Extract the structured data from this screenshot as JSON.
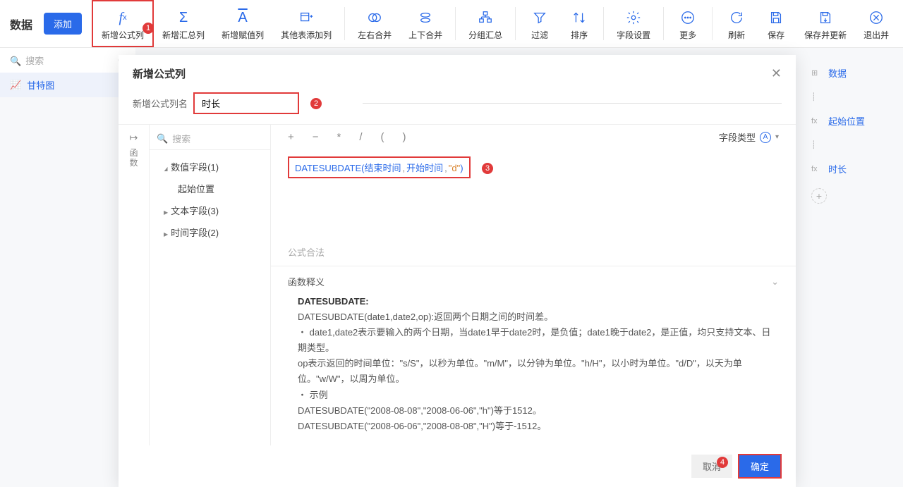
{
  "toolbar": {
    "title": "数据",
    "add": "添加",
    "items": [
      {
        "label": "新增公式列"
      },
      {
        "label": "新增汇总列"
      },
      {
        "label": "新增赋值列"
      },
      {
        "label": "其他表添加列"
      },
      {
        "label": "左右合并"
      },
      {
        "label": "上下合并"
      },
      {
        "label": "分组汇总"
      },
      {
        "label": "过滤"
      },
      {
        "label": "排序"
      },
      {
        "label": "字段设置"
      },
      {
        "label": "更多"
      },
      {
        "label": "刷新"
      },
      {
        "label": "保存"
      },
      {
        "label": "保存并更新"
      },
      {
        "label": "退出并"
      }
    ],
    "search_ph": "搜索",
    "gantt": "甘特图"
  },
  "right": {
    "data": "数据",
    "start": "起始位置",
    "dur": "时长"
  },
  "modal": {
    "title": "新增公式列",
    "name_label": "新增公式列名",
    "name_value": "时长",
    "ftype_label": "字段类型",
    "field_search_ph": "搜索",
    "tree": {
      "num": "数值字段(1)",
      "num_child": "起始位置",
      "text": "文本字段(3)",
      "time": "时间字段(2)"
    },
    "side_label": "函数",
    "formula": {
      "fn": "DATESUBDATE",
      "a1": "结束时间",
      "a2": "开始时间",
      "a3": "\"d\""
    },
    "valid": "公式合法",
    "help": {
      "title": "函数释义",
      "name": "DATESUBDATE:",
      "l1": "DATESUBDATE(date1,date2,op):返回两个日期之间的时间差。",
      "l2": "・ date1,date2表示要输入的两个日期，当date1早于date2时，是负值；date1晚于date2，是正值，均只支持文本、日期类型。",
      "l3": "op表示返回的时间单位：\"s/S\"，以秒为单位。\"m/M\"，以分钟为单位。\"h/H\"，以小时为单位。\"d/D\"，以天为单位。\"w/W\"，以周为单位。",
      "l4": "・ 示例",
      "l5": "DATESUBDATE(\"2008-08-08\",\"2008-06-06\",\"h\")等于1512。",
      "l6": "DATESUBDATE(\"2008-06-06\",\"2008-08-08\",\"H\")等于-1512。"
    },
    "cancel": "取消",
    "ok": "确定"
  },
  "badges": {
    "b1": "1",
    "b2": "2",
    "b3": "3",
    "b4": "4"
  }
}
